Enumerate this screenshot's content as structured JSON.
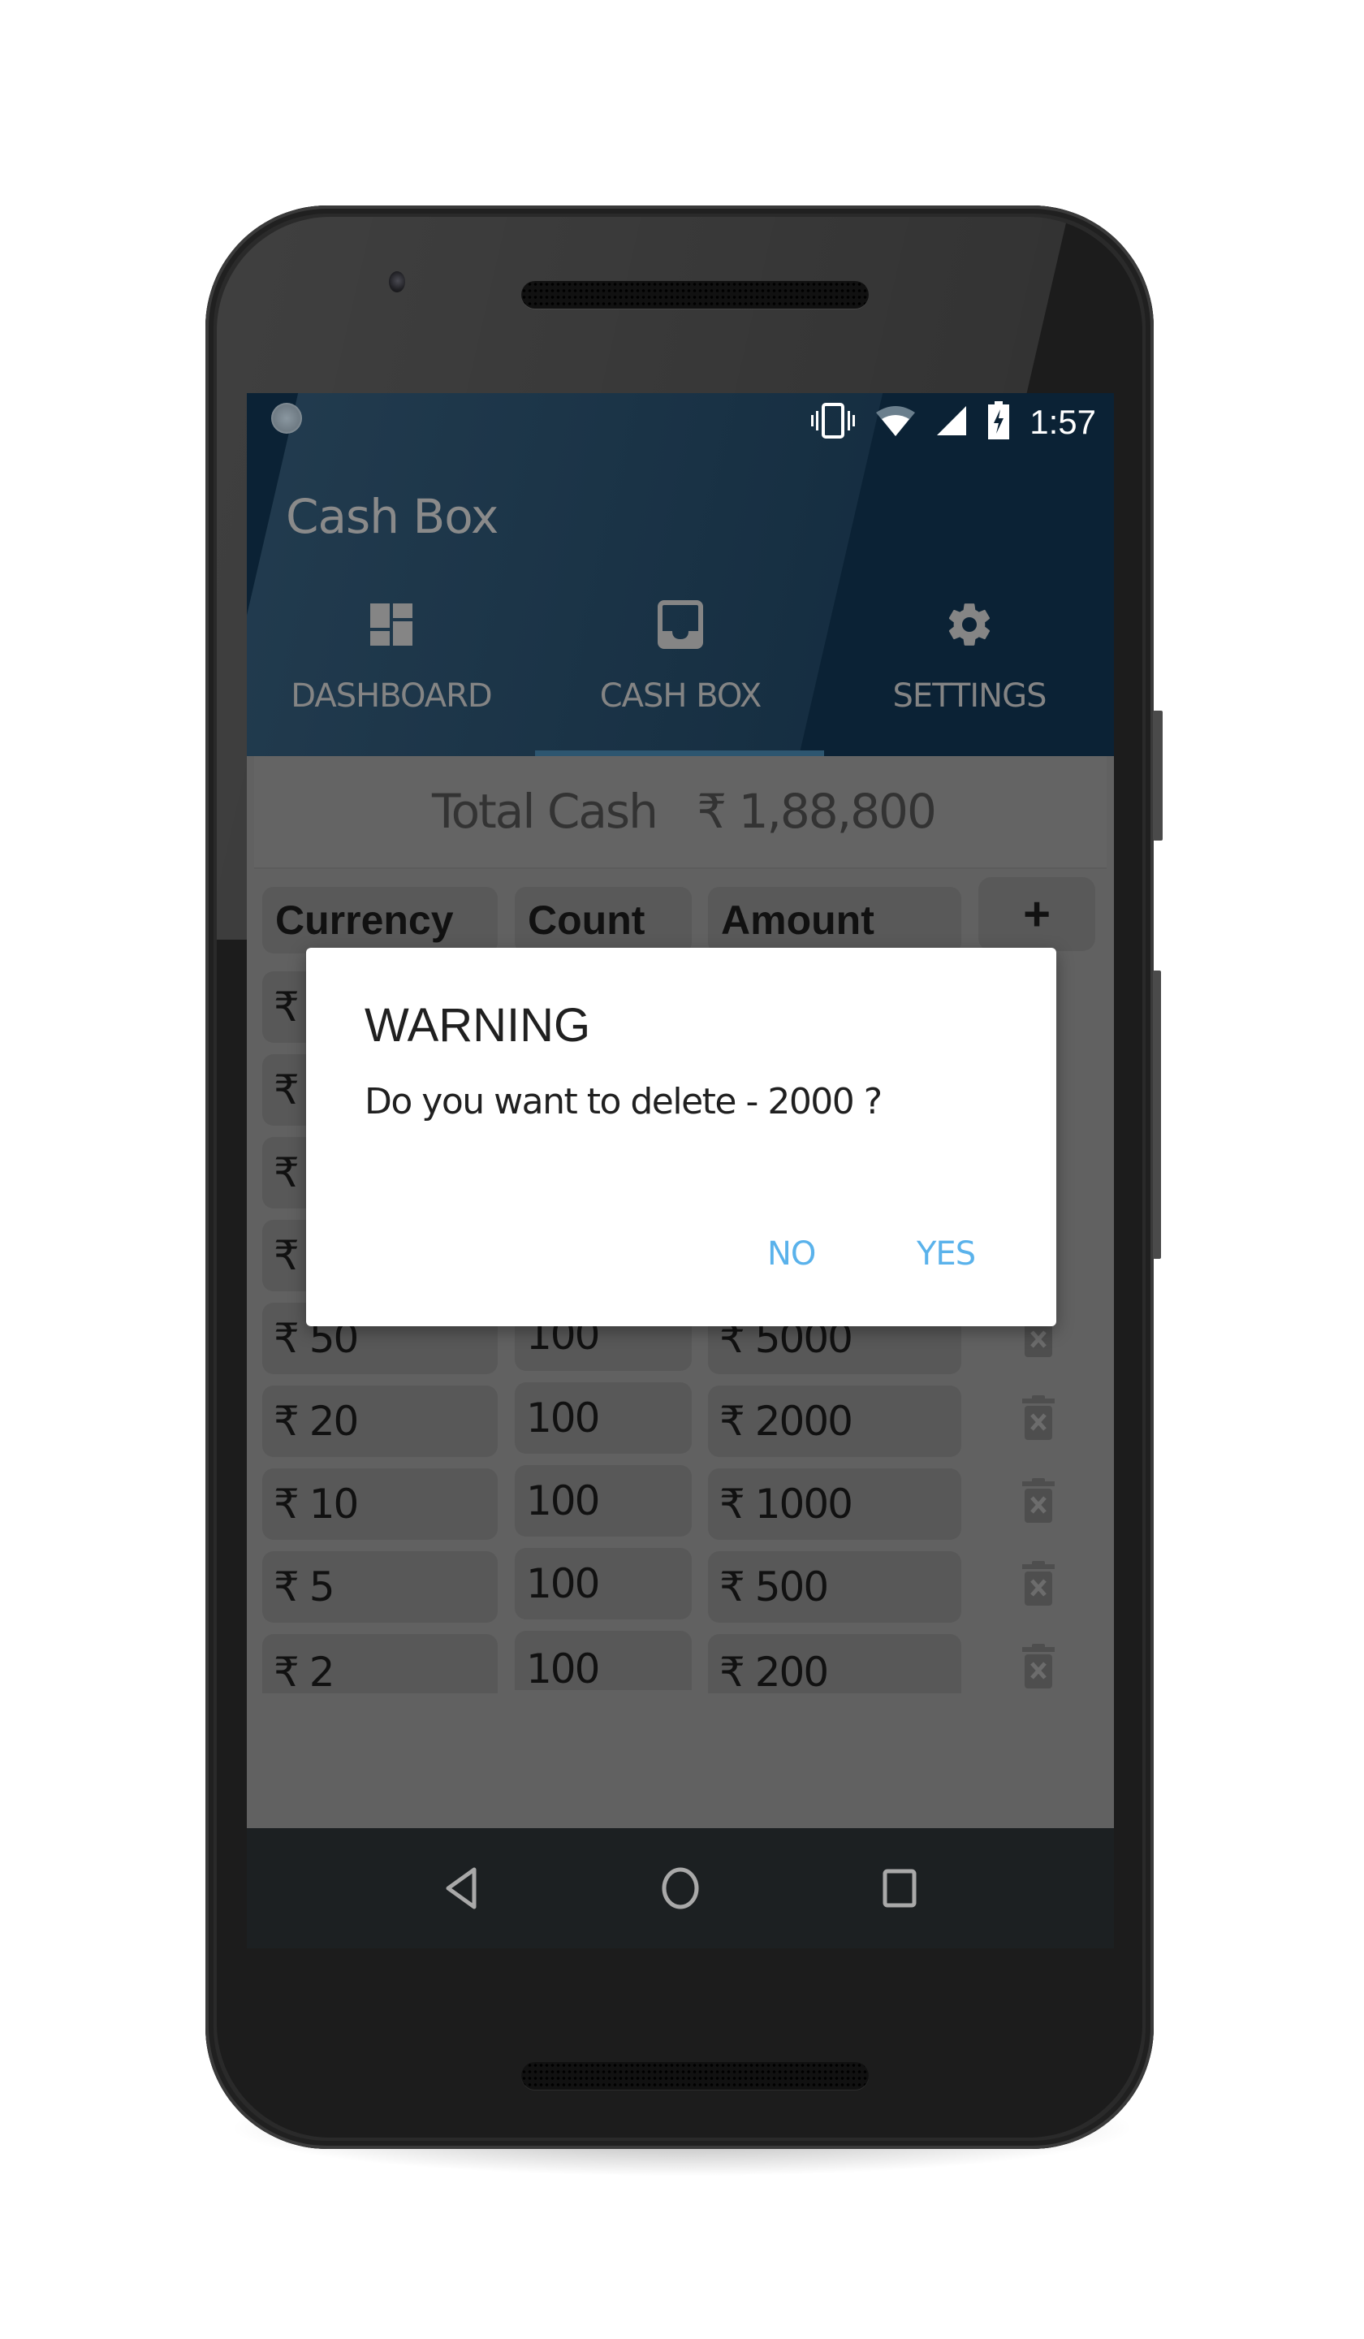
{
  "status_bar": {
    "time": "1:57",
    "icons": [
      "notification-dot-icon",
      "vibrate-icon",
      "wifi-icon",
      "cell-signal-icon",
      "battery-charging-icon"
    ]
  },
  "app": {
    "title": "Cash Box"
  },
  "tabs": [
    {
      "label": "DASHBOARD",
      "icon": "dashboard-icon",
      "selected": false
    },
    {
      "label": "CASH BOX",
      "icon": "inbox-icon",
      "selected": true
    },
    {
      "label": "SETTINGS",
      "icon": "gear-icon",
      "selected": false
    }
  ],
  "summary": {
    "label": "Total Cash",
    "value": "₹ 1,88,800"
  },
  "table": {
    "headers": {
      "currency": "Currency",
      "count": "Count",
      "amount": "Amount",
      "add": "+"
    },
    "rows": [
      {
        "currency": "₹",
        "count": "",
        "amount": ""
      },
      {
        "currency": "₹",
        "count": "",
        "amount": ""
      },
      {
        "currency": "₹",
        "count": "",
        "amount": ""
      },
      {
        "currency": "₹",
        "count": "",
        "amount": ""
      },
      {
        "currency": "₹ 50",
        "count": "100",
        "amount": "₹ 5000"
      },
      {
        "currency": "₹ 20",
        "count": "100",
        "amount": "₹ 2000"
      },
      {
        "currency": "₹ 10",
        "count": "100",
        "amount": "₹ 1000"
      },
      {
        "currency": "₹ 5",
        "count": "100",
        "amount": "₹ 500"
      },
      {
        "currency": "₹ 2",
        "count": "100",
        "amount": "₹ 200"
      }
    ]
  },
  "dialog": {
    "title": "WARNING",
    "message": "Do you want to delete - 2000 ?",
    "negative": "NO",
    "positive": "YES"
  },
  "colors": {
    "appbar": "#0b2235",
    "scrim_content": "#616161",
    "dialog_button": "#5ab2eb",
    "tab_indicator": "#2d5670"
  }
}
